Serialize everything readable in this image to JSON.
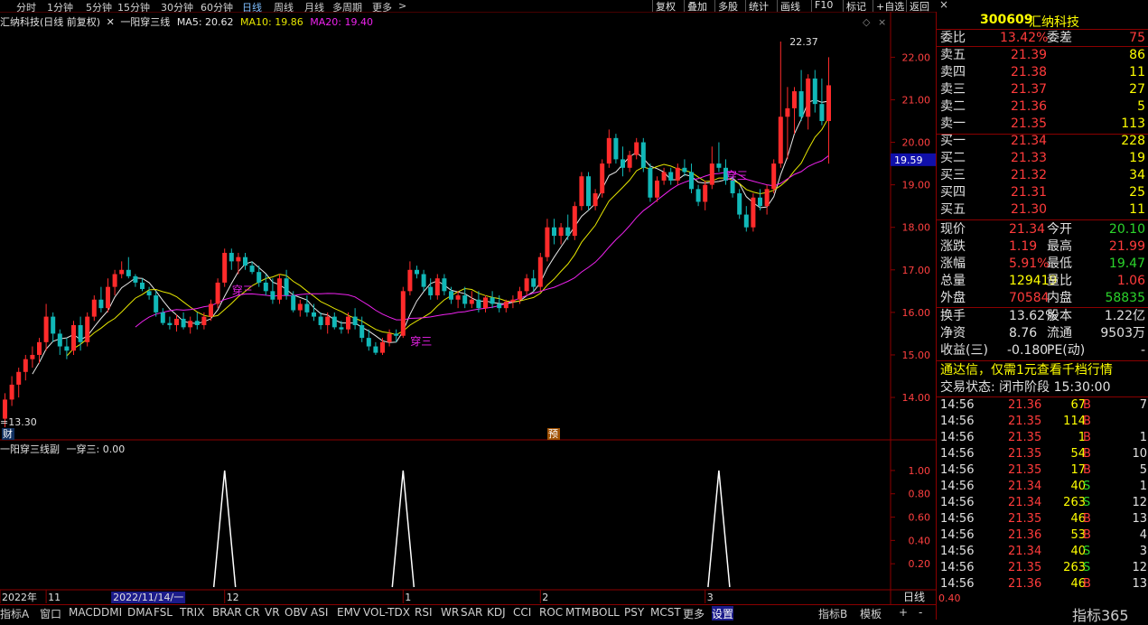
{
  "colors": {
    "up": "#ff2b2b",
    "down": "#11b8b8",
    "ma5": "#e8e8e8",
    "ma10": "#e6e600",
    "ma20": "#ee22ee",
    "axis_red": "#8b0000",
    "signal": "#ffffff"
  },
  "top_periods": [
    "分时",
    "1分钟",
    "5分钟",
    "15分钟",
    "30分钟",
    "60分钟",
    "日线",
    "周线",
    "月线",
    "多周期",
    "更多"
  ],
  "top_periods_active": "日线",
  "top_right_buttons": [
    "复权",
    "叠加",
    "多股",
    "统计",
    "画线",
    "F10",
    "标记",
    "+自选",
    "返回"
  ],
  "stock": {
    "code": "300609",
    "name": "汇纳科技"
  },
  "main_title": {
    "name": "汇纳科技(日线 前复权)",
    "indicator": "一阳穿三线",
    "ma5_label": "MA5: 20.62",
    "ma10_label": "MA10: 19.86",
    "ma20_label": "MA20: 19.40"
  },
  "main_annotations": {
    "high": "22.37",
    "low": "13.30",
    "cur_price": "19.59",
    "cai": "财",
    "yu": "预",
    "signal_text": "穿三"
  },
  "sub_title": {
    "name": "一阳穿三线副",
    "value": "一穿三: 0.00"
  },
  "chart_data": [
    {
      "type": "candlestick",
      "ylim": [
        13.3,
        22.9
      ],
      "yticks": [
        "22.00",
        "21.00",
        "20.00",
        "19.00",
        "18.00",
        "17.00",
        "16.00",
        "15.00",
        "14.00"
      ],
      "signal_bars": [
        32,
        58,
        104
      ],
      "ohlc": [
        [
          13.5,
          14.1,
          13.3,
          13.95
        ],
        [
          13.95,
          14.5,
          13.8,
          14.3
        ],
        [
          14.3,
          14.7,
          14.0,
          14.6
        ],
        [
          14.6,
          15.0,
          14.4,
          14.9
        ],
        [
          14.9,
          15.2,
          14.7,
          15.0
        ],
        [
          15.0,
          15.4,
          14.8,
          15.3
        ],
        [
          15.3,
          16.2,
          15.1,
          15.9
        ],
        [
          15.9,
          16.0,
          15.3,
          15.5
        ],
        [
          15.5,
          15.6,
          15.0,
          15.2
        ],
        [
          15.2,
          15.4,
          14.9,
          15.1
        ],
        [
          15.1,
          15.8,
          15.0,
          15.7
        ],
        [
          15.7,
          15.9,
          15.1,
          15.3
        ],
        [
          15.3,
          16.0,
          15.2,
          15.9
        ],
        [
          15.9,
          16.4,
          15.8,
          16.3
        ],
        [
          16.3,
          16.6,
          16.0,
          16.1
        ],
        [
          16.1,
          16.8,
          16.0,
          16.6
        ],
        [
          16.6,
          17.0,
          16.4,
          16.9
        ],
        [
          16.9,
          17.2,
          16.8,
          17.0
        ],
        [
          17.0,
          17.3,
          16.8,
          16.85
        ],
        [
          16.85,
          16.9,
          16.6,
          16.7
        ],
        [
          16.7,
          16.8,
          16.5,
          16.55
        ],
        [
          16.5,
          16.6,
          16.3,
          16.4
        ],
        [
          16.4,
          16.5,
          15.9,
          16.0
        ],
        [
          16.0,
          16.1,
          15.7,
          15.75
        ],
        [
          15.75,
          15.9,
          15.6,
          15.7
        ],
        [
          15.7,
          15.95,
          15.55,
          15.85
        ],
        [
          15.85,
          16.0,
          15.6,
          15.65
        ],
        [
          15.65,
          15.9,
          15.5,
          15.8
        ],
        [
          15.8,
          16.0,
          15.6,
          15.7
        ],
        [
          15.7,
          16.0,
          15.6,
          15.9
        ],
        [
          15.9,
          16.3,
          15.8,
          16.2
        ],
        [
          16.2,
          16.8,
          16.1,
          16.7
        ],
        [
          16.7,
          17.5,
          16.6,
          17.4
        ],
        [
          17.4,
          17.5,
          17.0,
          17.2
        ],
        [
          17.2,
          17.4,
          16.9,
          17.3
        ],
        [
          17.3,
          17.4,
          17.0,
          17.1
        ],
        [
          17.1,
          17.2,
          16.9,
          16.95
        ],
        [
          16.95,
          17.1,
          16.6,
          16.7
        ],
        [
          16.7,
          16.9,
          16.4,
          16.5
        ],
        [
          16.5,
          16.8,
          16.2,
          16.3
        ],
        [
          16.3,
          16.9,
          16.2,
          16.8
        ],
        [
          16.8,
          17.0,
          16.3,
          16.4
        ],
        [
          16.4,
          16.5,
          16.0,
          16.05
        ],
        [
          16.05,
          16.3,
          15.9,
          16.2
        ],
        [
          16.2,
          16.4,
          15.9,
          16.0
        ],
        [
          16.0,
          16.2,
          15.8,
          15.9
        ],
        [
          15.9,
          16.0,
          15.6,
          15.7
        ],
        [
          15.7,
          16.0,
          15.5,
          15.9
        ],
        [
          15.9,
          16.0,
          15.6,
          15.65
        ],
        [
          15.65,
          15.8,
          15.5,
          15.6
        ],
        [
          15.6,
          16.0,
          15.5,
          15.9
        ],
        [
          15.9,
          16.1,
          15.6,
          15.7
        ],
        [
          15.7,
          15.9,
          15.3,
          15.4
        ],
        [
          15.4,
          15.6,
          15.1,
          15.2
        ],
        [
          15.2,
          15.3,
          15.0,
          15.05
        ],
        [
          15.05,
          15.4,
          15.0,
          15.3
        ],
        [
          15.3,
          15.6,
          15.2,
          15.5
        ],
        [
          15.5,
          15.6,
          15.3,
          15.45
        ],
        [
          15.45,
          16.6,
          15.4,
          16.5
        ],
        [
          16.5,
          17.2,
          16.4,
          17.0
        ],
        [
          17.0,
          17.1,
          16.8,
          16.9
        ],
        [
          16.9,
          17.0,
          16.5,
          16.6
        ],
        [
          16.6,
          16.8,
          16.3,
          16.4
        ],
        [
          16.4,
          16.9,
          16.3,
          16.8
        ],
        [
          16.8,
          16.9,
          16.4,
          16.5
        ],
        [
          16.5,
          16.6,
          16.2,
          16.3
        ],
        [
          16.3,
          16.5,
          16.1,
          16.4
        ],
        [
          16.4,
          16.6,
          16.1,
          16.2
        ],
        [
          16.2,
          16.5,
          16.1,
          16.3
        ],
        [
          16.3,
          16.5,
          16.0,
          16.1
        ],
        [
          16.1,
          16.4,
          16.0,
          16.35
        ],
        [
          16.35,
          16.5,
          16.1,
          16.2
        ],
        [
          16.2,
          16.4,
          16.0,
          16.1
        ],
        [
          16.1,
          16.3,
          16.0,
          16.25
        ],
        [
          16.25,
          16.4,
          16.1,
          16.3
        ],
        [
          16.3,
          16.6,
          16.2,
          16.5
        ],
        [
          16.5,
          16.9,
          16.4,
          16.8
        ],
        [
          16.8,
          17.0,
          16.5,
          16.6
        ],
        [
          16.6,
          17.4,
          16.5,
          17.3
        ],
        [
          17.3,
          18.2,
          17.2,
          18.0
        ],
        [
          18.0,
          18.2,
          17.6,
          17.8
        ],
        [
          17.8,
          18.1,
          17.6,
          18.0
        ],
        [
          18.0,
          18.3,
          17.7,
          17.8
        ],
        [
          17.8,
          18.6,
          17.7,
          18.5
        ],
        [
          18.5,
          19.3,
          18.4,
          19.2
        ],
        [
          19.2,
          19.3,
          18.4,
          18.5
        ],
        [
          18.5,
          18.9,
          18.4,
          18.8
        ],
        [
          18.8,
          19.6,
          18.7,
          19.5
        ],
        [
          19.5,
          20.3,
          19.4,
          20.1
        ],
        [
          20.1,
          20.2,
          19.5,
          19.6
        ],
        [
          19.6,
          19.9,
          19.2,
          19.4
        ],
        [
          19.4,
          19.8,
          19.3,
          19.7
        ],
        [
          19.7,
          20.1,
          19.6,
          20.0
        ],
        [
          20.0,
          20.1,
          19.3,
          19.4
        ],
        [
          19.4,
          19.5,
          18.6,
          18.7
        ],
        [
          18.7,
          19.2,
          18.6,
          19.1
        ],
        [
          19.1,
          19.4,
          19.0,
          19.3
        ],
        [
          19.3,
          19.4,
          19.0,
          19.1
        ],
        [
          19.1,
          19.5,
          19.0,
          19.4
        ],
        [
          19.4,
          19.6,
          19.2,
          19.3
        ],
        [
          19.3,
          19.5,
          18.8,
          18.9
        ],
        [
          18.9,
          19.0,
          18.5,
          18.6
        ],
        [
          18.6,
          19.1,
          18.4,
          19.0
        ],
        [
          19.0,
          19.9,
          18.9,
          19.5
        ],
        [
          19.5,
          20.0,
          19.3,
          19.4
        ],
        [
          19.4,
          19.6,
          19.0,
          19.1
        ],
        [
          19.1,
          19.2,
          18.7,
          18.8
        ],
        [
          18.8,
          18.9,
          18.2,
          18.3
        ],
        [
          18.3,
          18.5,
          17.9,
          18.0
        ],
        [
          18.0,
          18.8,
          17.9,
          18.7
        ],
        [
          18.7,
          18.9,
          18.4,
          18.5
        ],
        [
          18.5,
          19.0,
          18.3,
          18.9
        ],
        [
          18.9,
          19.6,
          18.8,
          19.5
        ],
        [
          19.5,
          22.37,
          19.4,
          20.6
        ],
        [
          20.6,
          21.3,
          19.6,
          20.8
        ],
        [
          20.8,
          21.3,
          20.2,
          21.2
        ],
        [
          21.2,
          21.7,
          20.5,
          20.6
        ],
        [
          20.6,
          21.6,
          20.3,
          21.5
        ],
        [
          21.5,
          21.7,
          20.7,
          20.9
        ],
        [
          20.9,
          21.5,
          20.4,
          20.5
        ],
        [
          20.5,
          22.0,
          19.5,
          21.34
        ]
      ]
    },
    {
      "type": "line",
      "name": "一穿三",
      "ylim": [
        0,
        1.1
      ],
      "yticks": [
        "1.00",
        "0.80",
        "0.60",
        "0.40",
        "0.20"
      ],
      "signal_bars": [
        32,
        58,
        104
      ]
    }
  ],
  "x_labels": [
    {
      "label": "2022年",
      "bar": 0
    },
    {
      "label": "11",
      "bar": 6
    },
    {
      "label": "2022/11/14/一",
      "bar": 16
    },
    {
      "label": "12",
      "bar": 32
    },
    {
      "label": "1",
      "bar": 58
    },
    {
      "label": "2",
      "bar": 78
    },
    {
      "label": "3",
      "bar": 102
    }
  ],
  "quote": {
    "wb": {
      "label": "委比",
      "value": "13.42%",
      "diff_label": "委差",
      "diff": "75"
    },
    "sells": [
      {
        "label": "卖五",
        "price": "21.39",
        "vol": "86"
      },
      {
        "label": "卖四",
        "price": "21.38",
        "vol": "11"
      },
      {
        "label": "卖三",
        "price": "21.37",
        "vol": "27"
      },
      {
        "label": "卖二",
        "price": "21.36",
        "vol": "5"
      },
      {
        "label": "卖一",
        "price": "21.35",
        "vol": "113"
      }
    ],
    "buys": [
      {
        "label": "买一",
        "price": "21.34",
        "vol": "228"
      },
      {
        "label": "买二",
        "price": "21.33",
        "vol": "19"
      },
      {
        "label": "买三",
        "price": "21.32",
        "vol": "34"
      },
      {
        "label": "买四",
        "price": "21.31",
        "vol": "25"
      },
      {
        "label": "买五",
        "price": "21.30",
        "vol": "11"
      }
    ],
    "stats": [
      {
        "l1": "现价",
        "v1": "21.34",
        "c1": "#ff3b3b",
        "l2": "今开",
        "v2": "20.10",
        "c2": "#2bd42b"
      },
      {
        "l1": "涨跌",
        "v1": "1.19",
        "c1": "#ff3b3b",
        "l2": "最高",
        "v2": "21.99",
        "c2": "#ff3b3b"
      },
      {
        "l1": "涨幅",
        "v1": "5.91%",
        "c1": "#ff3b3b",
        "l2": "最低",
        "v2": "19.47",
        "c2": "#2bd42b"
      },
      {
        "l1": "总量",
        "v1": "129419",
        "c1": "#ffff00",
        "l2": "量比",
        "v2": "1.06",
        "c2": "#ff3b3b"
      },
      {
        "l1": "外盘",
        "v1": "70584",
        "c1": "#ff3b3b",
        "l2": "内盘",
        "v2": "58835",
        "c2": "#2bd42b"
      },
      {
        "l1": "换手",
        "v1": "13.62%",
        "c1": "#e0e0e0",
        "l2": "股本",
        "v2": "1.22亿",
        "c2": "#e0e0e0"
      },
      {
        "l1": "净资",
        "v1": "8.76",
        "c1": "#e0e0e0",
        "l2": "流通",
        "v2": "9503万",
        "c2": "#e0e0e0"
      },
      {
        "l1": "收益(三)",
        "v1": "-0.180",
        "c1": "#e0e0e0",
        "l2": "PE(动)",
        "v2": "-",
        "c2": "#e0e0e0"
      }
    ],
    "ad": "通达信，仅需1元查看千档行情",
    "status": "交易状态: 闭市阶段 15:30:00",
    "ticks": [
      {
        "time": "14:56",
        "price": "21.36",
        "vol": "67",
        "bs": "B",
        "n": "7"
      },
      {
        "time": "14:56",
        "price": "21.35",
        "vol": "114",
        "bs": "B",
        "n": ""
      },
      {
        "time": "14:56",
        "price": "21.35",
        "vol": "1",
        "bs": "B",
        "n": "1"
      },
      {
        "time": "14:56",
        "price": "21.35",
        "vol": "54",
        "bs": "B",
        "n": "10"
      },
      {
        "time": "14:56",
        "price": "21.35",
        "vol": "17",
        "bs": "B",
        "n": "5"
      },
      {
        "time": "14:56",
        "price": "21.34",
        "vol": "40",
        "bs": "S",
        "n": "1"
      },
      {
        "time": "14:56",
        "price": "21.34",
        "vol": "263",
        "bs": "S",
        "n": "12"
      },
      {
        "time": "14:56",
        "price": "21.35",
        "vol": "46",
        "bs": "B",
        "n": "13"
      },
      {
        "time": "14:56",
        "price": "21.36",
        "vol": "53",
        "bs": "B",
        "n": "4"
      },
      {
        "time": "14:56",
        "price": "21.34",
        "vol": "40",
        "bs": "S",
        "n": "3"
      },
      {
        "time": "14:56",
        "price": "21.35",
        "vol": "263",
        "bs": "S",
        "n": "12"
      },
      {
        "time": "14:56",
        "price": "21.36",
        "vol": "46",
        "bs": "B",
        "n": "13"
      }
    ],
    "period_label": "日线"
  },
  "bottom_tabs": [
    "指标A",
    "窗口",
    "MACD",
    "DMI",
    "DMA",
    "FSL",
    "TRIX",
    "BRAR",
    "CR",
    "VR",
    "OBV",
    "ASI",
    "EMV",
    "VOL-TDX",
    "RSI",
    "WR",
    "SAR",
    "KDJ",
    "CCI",
    "ROC",
    "MTM",
    "BOLL",
    "PSY",
    "MCST",
    "更多",
    "设置"
  ],
  "bottom_right": [
    "指标B",
    "模板",
    "+",
    "-"
  ],
  "watermark": "指标365",
  "sub_axis_bottom": "0.40"
}
